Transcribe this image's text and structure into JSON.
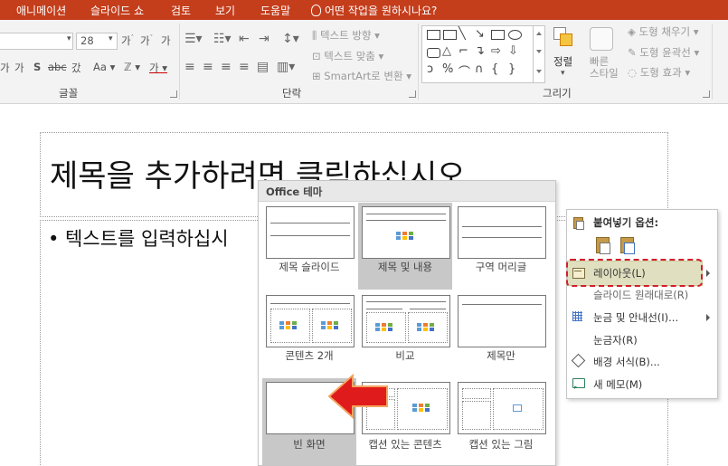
{
  "tabs": [
    "애니메이션",
    "슬라이드 쇼",
    "검토",
    "보기",
    "도움말"
  ],
  "tell_me": "어떤 작업을 원하시나요?",
  "ribbon": {
    "font_size": "28",
    "font_group_label": "글꼴",
    "paragraph_group_label": "단락",
    "drawing_group_label": "그리기",
    "text_direction": "텍스트 방향",
    "text_align": "텍스트 맞춤",
    "smartart": "SmartArt로 변환",
    "arrange": "정렬",
    "quick_styles": "빠른\n스타일",
    "shape_fill": "도형 채우기",
    "shape_outline": "도형 윤곽선",
    "shape_effects": "도형 효과"
  },
  "slide": {
    "title_placeholder": "제목을 추가하려면 클릭하십시오",
    "body_placeholder": "• 텍스트를 입력하십시"
  },
  "layout_menu": {
    "header": "Office 테마",
    "layouts": [
      "제목 슬라이드",
      "제목 및 내용",
      "구역 머리글",
      "콘텐츠 2개",
      "비교",
      "제목만",
      "빈 화면",
      "캡션 있는 콘텐츠",
      "캡션 있는 그림"
    ],
    "selected": "제목 및 내용"
  },
  "context_menu": {
    "paste_header": "붙여넣기 옵션:",
    "layout": "레이아웃(L)",
    "reset_slide": "슬라이드 원래대로(R)",
    "grid_guides": "눈금 및 안내선(I)...",
    "ruler": "눈금자(R)",
    "format_background": "배경 서식(B)...",
    "new_comment": "새 메모(M)"
  },
  "colors": {
    "accent": "#c43e1c",
    "arrow": "#e01b1b",
    "highlight": "#e0e0c0"
  }
}
